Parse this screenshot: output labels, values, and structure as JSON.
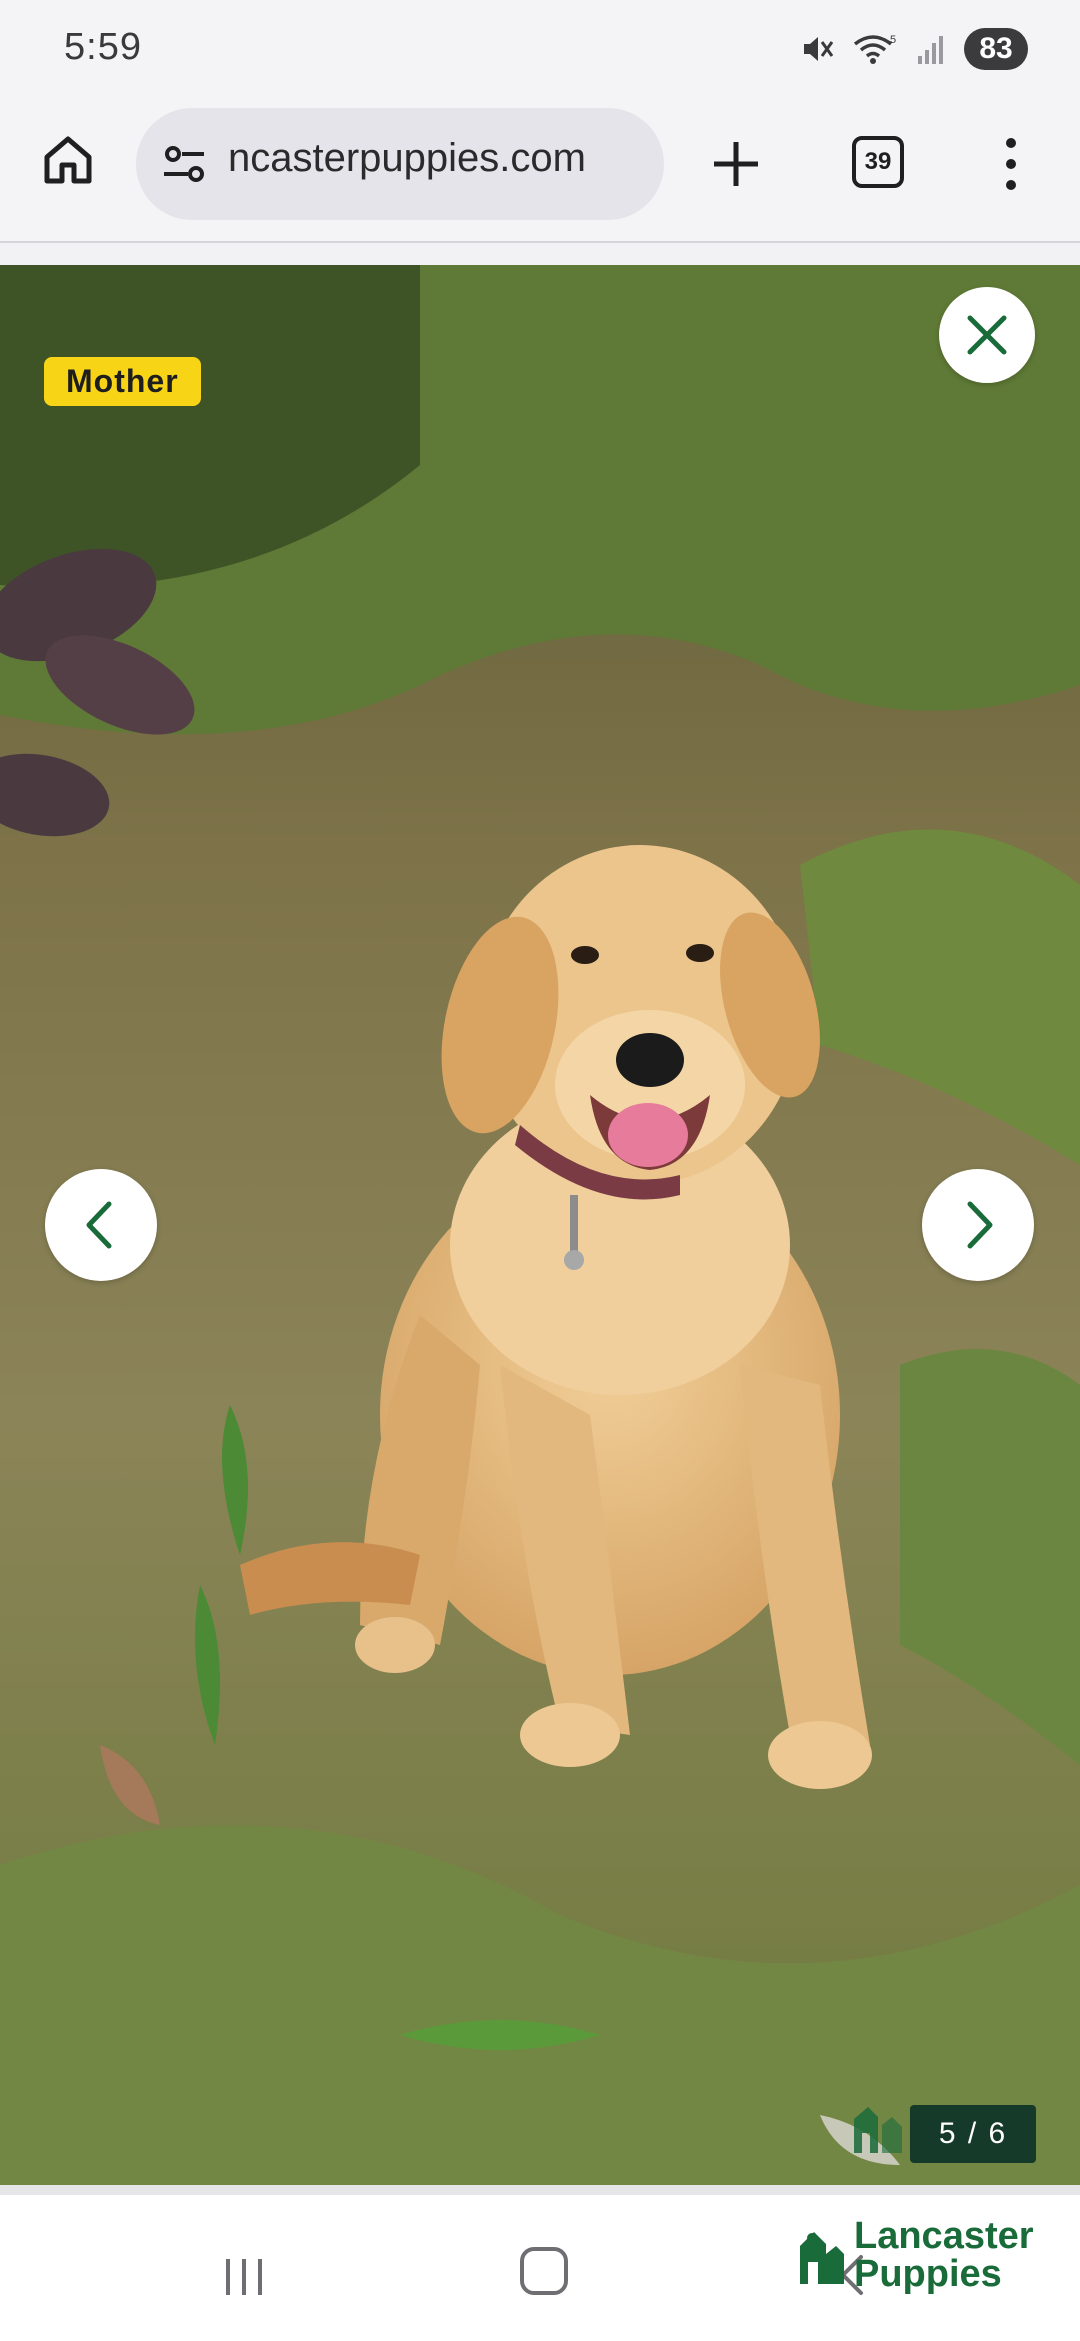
{
  "status_bar": {
    "time": "5:59",
    "battery": "83",
    "wifi_label": "5",
    "icons": [
      "mute-icon",
      "wifi-icon",
      "signal-icon",
      "battery-icon"
    ]
  },
  "browser": {
    "url": "ncasterpuppies.com",
    "tab_count": "39",
    "icons": [
      "home-icon",
      "site-settings-icon",
      "new-tab-icon",
      "tab-switcher-icon",
      "more-menu-icon"
    ]
  },
  "lightbox": {
    "badge": "Mother",
    "counter": "5 / 6",
    "current": 5,
    "total": 6,
    "accent_color": "#1a6b3a",
    "badge_color": "#f8d417"
  },
  "brand": {
    "line1": "Lancaster",
    "line2": "Puppies",
    "color": "#1a6b3a"
  }
}
